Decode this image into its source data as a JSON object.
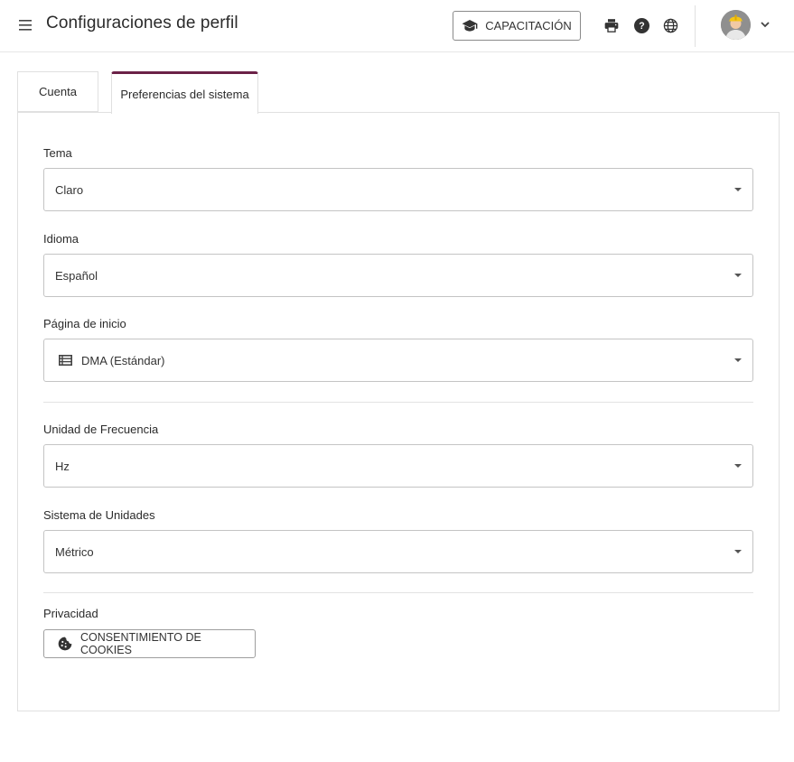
{
  "header": {
    "title": "Configuraciones de perfil",
    "training_label": "CAPACITACIÓN",
    "icons": [
      "menu-icon",
      "graduation-cap-icon",
      "print-icon",
      "help-icon",
      "globe-icon",
      "avatar",
      "chevron-down-icon"
    ]
  },
  "tabs": [
    {
      "label": "Cuenta",
      "active": false
    },
    {
      "label": "Preferencias del sistema",
      "active": true
    }
  ],
  "form": {
    "theme": {
      "label": "Tema",
      "value": "Claro"
    },
    "language": {
      "label": "Idioma",
      "value": "Español"
    },
    "home_page": {
      "label": "Página de inicio",
      "value": "DMA (Estándar)",
      "icon": "list-icon"
    },
    "frequency_unit": {
      "label": "Unidad de Frecuencia",
      "value": "Hz"
    },
    "unit_system": {
      "label": "Sistema de Unidades",
      "value": "Métrico"
    },
    "privacy": {
      "label": "Privacidad",
      "cookie_button": "CONSENTIMIENTO DE COOKIES",
      "icon": "cookie-icon"
    }
  },
  "colors": {
    "active_tab_accent": "#6b2147",
    "border": "#c4c4c4"
  }
}
